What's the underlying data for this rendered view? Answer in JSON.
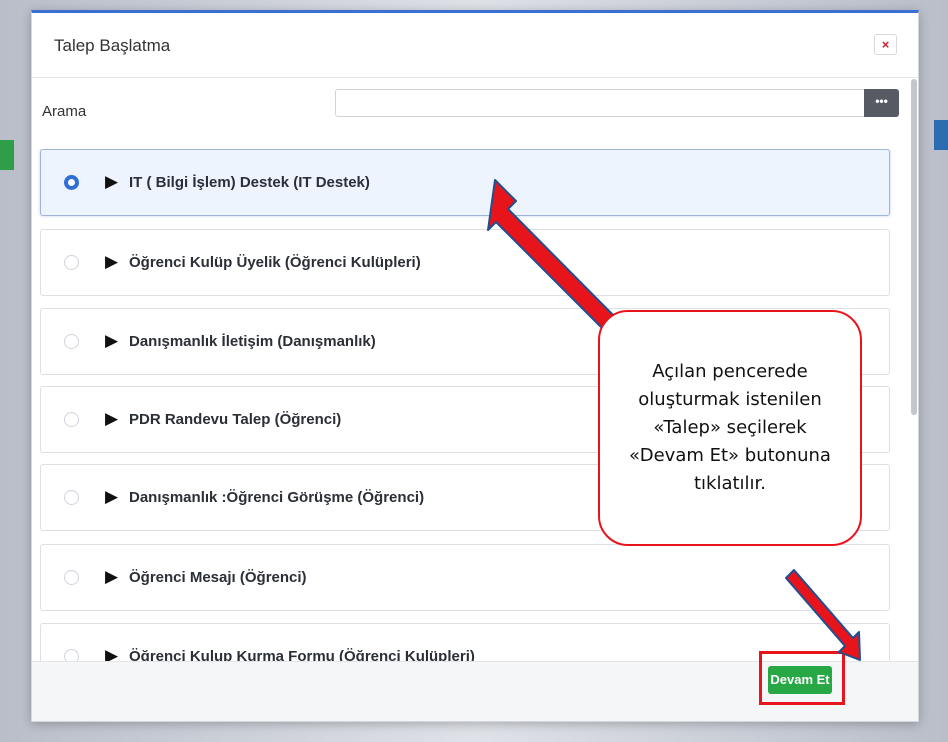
{
  "modal": {
    "title": "Talep Başlatma",
    "close_label": "×",
    "search": {
      "label": "Arama",
      "value": "",
      "button_label": "•••"
    },
    "items": [
      {
        "label": "IT ( Bilgi İşlem) Destek (IT Destek)",
        "selected": true
      },
      {
        "label": "Öğrenci Kulüp Üyelik (Öğrenci Kulüpleri)",
        "selected": false
      },
      {
        "label": "Danışmanlık İletişim (Danışmanlık)",
        "selected": false
      },
      {
        "label": "PDR Randevu Talep (Öğrenci)",
        "selected": false
      },
      {
        "label": "Danışmanlık :Öğrenci Görüşme (Öğrenci)",
        "selected": false
      },
      {
        "label": "Öğrenci Mesajı (Öğrenci)",
        "selected": false
      },
      {
        "label": "Öğrenci Kulup Kurma Formu (Öğrenci Kulüpleri)",
        "selected": false
      }
    ],
    "continue_label": "Devam Et"
  },
  "callout": {
    "text": "Açılan pencerede\noluşturmak istenilen\n«Talep» seçilerek\n«Devam Et» butonuna\ntıklatılır."
  },
  "colors": {
    "accent": "#3b6fd1",
    "annotation": "#e8141c",
    "success": "#28a745"
  }
}
